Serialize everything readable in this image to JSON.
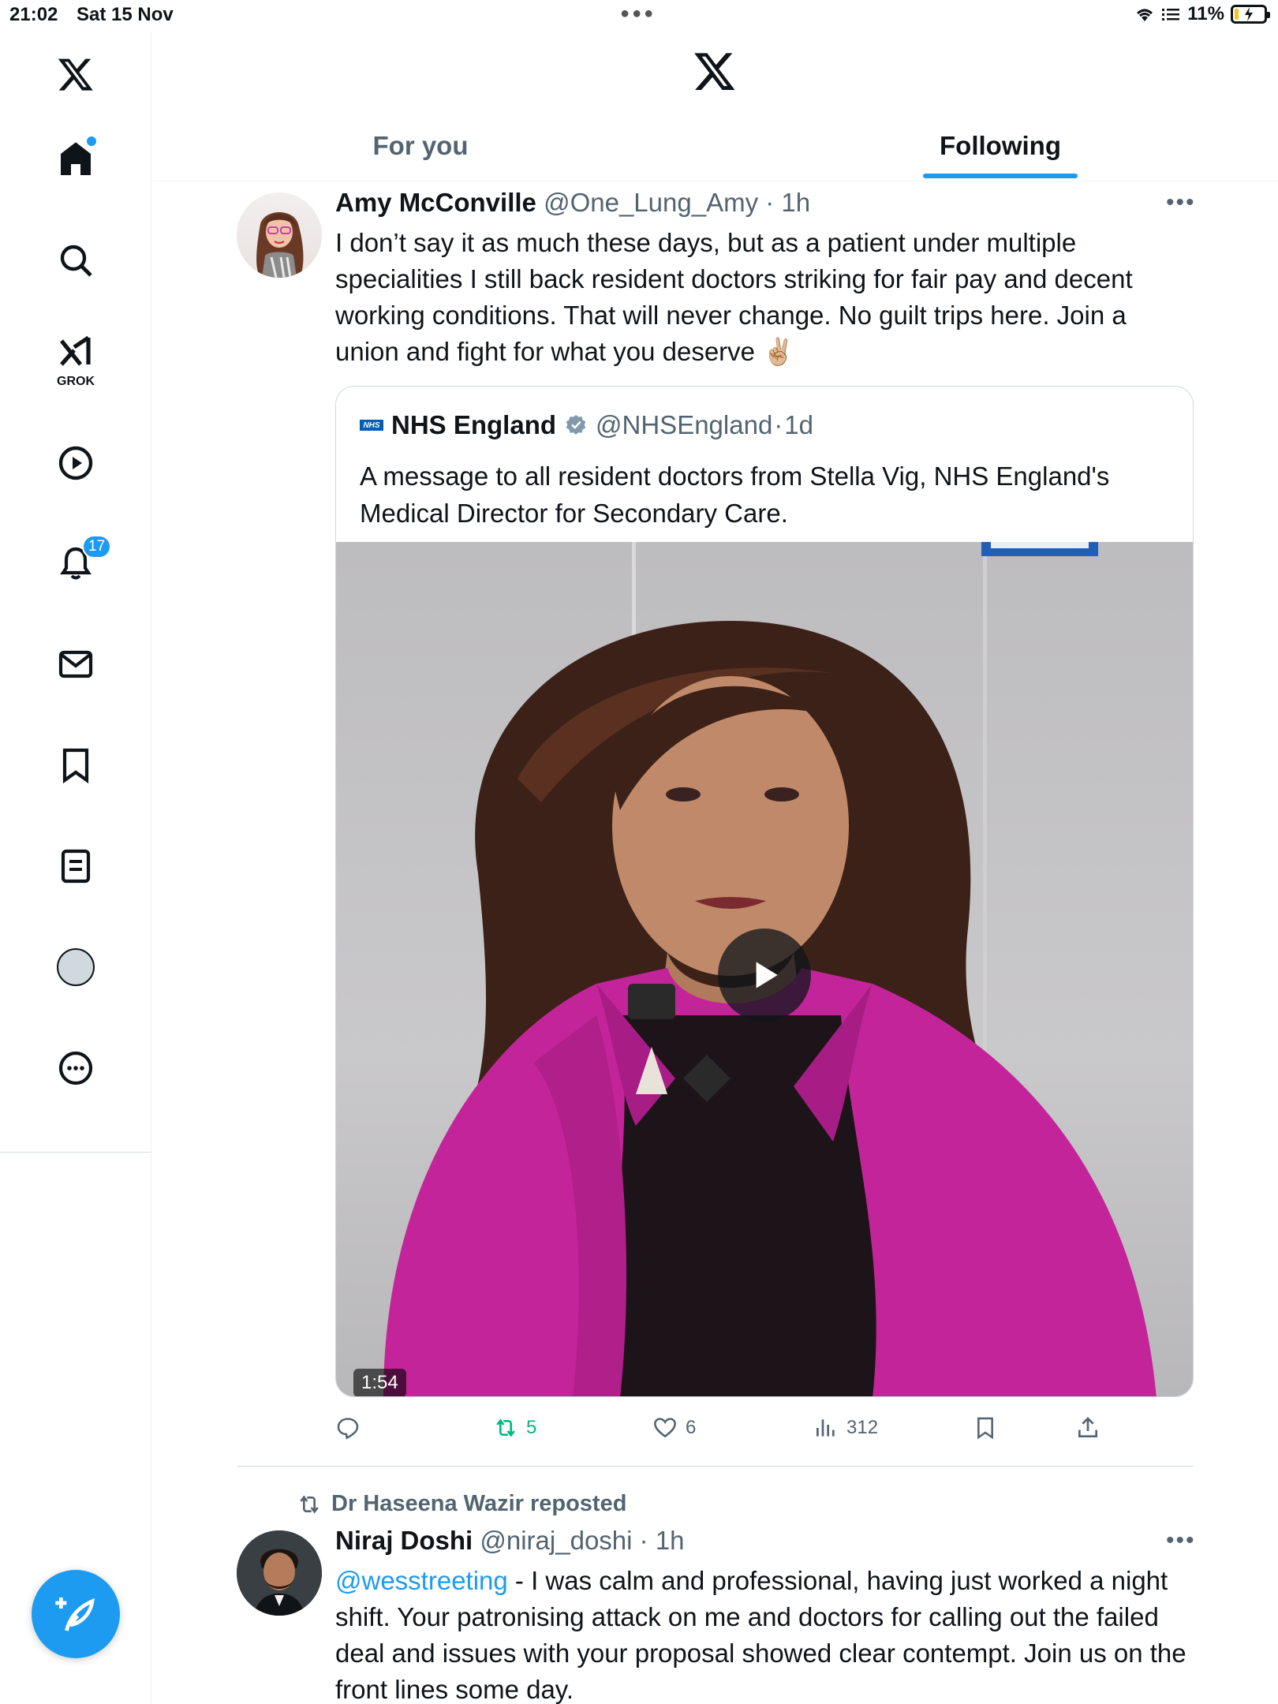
{
  "status_bar": {
    "time": "21:02",
    "date": "Sat 15 Nov",
    "battery": "11%"
  },
  "sidebar": {
    "items": [
      {
        "name": "home",
        "icon": "home-icon"
      },
      {
        "name": "explore",
        "icon": "search-icon"
      },
      {
        "name": "grok",
        "icon": "grok-icon",
        "label": "GROK"
      },
      {
        "name": "video",
        "icon": "play-icon"
      },
      {
        "name": "notifications",
        "icon": "bell-icon",
        "badge": "17"
      },
      {
        "name": "messages",
        "icon": "mail-icon"
      },
      {
        "name": "bookmarks",
        "icon": "bookmark-icon"
      },
      {
        "name": "lists",
        "icon": "list-icon"
      },
      {
        "name": "profile",
        "icon": "avatar"
      },
      {
        "name": "more",
        "icon": "more-circle-icon"
      }
    ]
  },
  "tabs": {
    "for_you": "For you",
    "following": "Following"
  },
  "tweets": [
    {
      "name": "Amy McConville",
      "handle": "@One_Lung_Amy",
      "time": "1h",
      "text": "I don’t say it as much these days, but as a patient under multiple specialities I still back resident doctors striking for fair pay and decent working conditions. That will never change. No guilt trips here. Join a union and fight for what you deserve ✌🏼",
      "quote": {
        "name": "NHS England",
        "handle": "@NHSEngland",
        "time": "1d",
        "logo_text": "NHS",
        "text": "A message to all resident doctors from Stella Vig, NHS England's Medical Director for Secondary Care.",
        "video_duration": "1:54"
      },
      "actions": {
        "replies": "",
        "reposts": "5",
        "likes": "6",
        "views": "312"
      }
    },
    {
      "reposted_by": "Dr Haseena Wazir reposted",
      "name": "Niraj Doshi",
      "handle": "@niraj_doshi",
      "time": "1h",
      "mention": "@wesstreeting",
      "text": " - I was calm and professional, having just worked a night shift. Your patronising attack on me and doctors for calling out the failed deal and issues with your proposal showed clear contempt. Join us on the front lines some day."
    }
  ],
  "colors": {
    "accent": "#1d9bf0",
    "secondary_text": "#536471",
    "repost_green": "#00ba7c",
    "jacket": "#c4249a"
  }
}
